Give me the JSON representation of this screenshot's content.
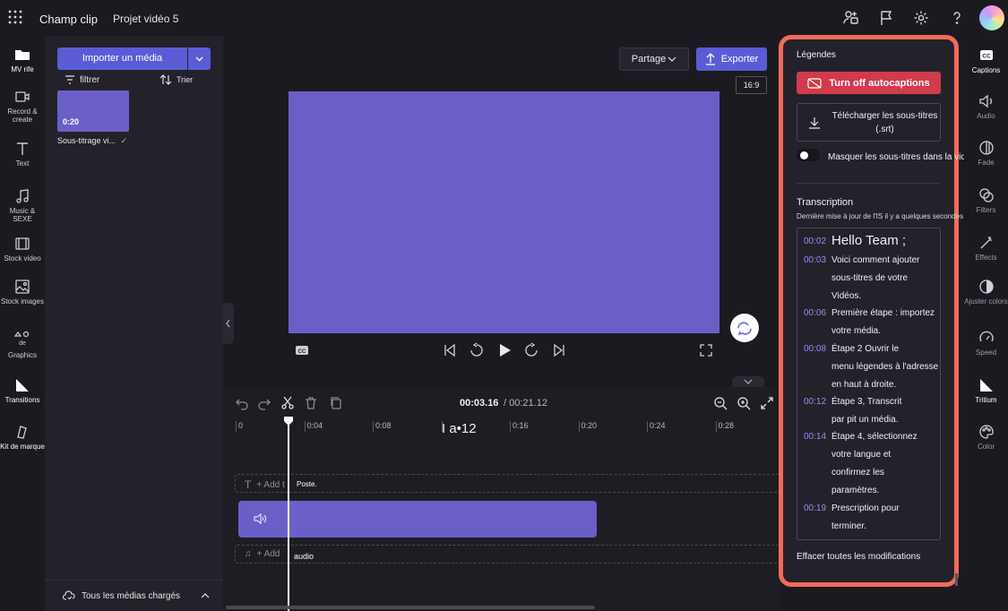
{
  "header": {
    "app_title": "Champ clip",
    "project_name": "Projet vidéo 5"
  },
  "left_rail": {
    "items": [
      {
        "label": "MV rife",
        "icon": "folder-icon"
      },
      {
        "label": "Record & create",
        "icon": "video-camera-icon"
      },
      {
        "label": "Text",
        "icon": "text-icon"
      },
      {
        "label": "Music & SEXE",
        "icon": "music-icon"
      },
      {
        "label": "Stock video",
        "icon": "film-icon"
      },
      {
        "label": "Stock images",
        "icon": "image-icon"
      },
      {
        "label": "Graphics",
        "icon": "shapes-icon"
      },
      {
        "label": "Transitions",
        "icon": "transition-icon"
      },
      {
        "label": "Kit de marque",
        "icon": "brand-kit-icon"
      }
    ],
    "graphics_badge": "de"
  },
  "media_panel": {
    "import_label": "Importer un média",
    "filter_label": "filtrer",
    "sort_label": "Trier",
    "media_item": {
      "duration": "0:20",
      "name": "Sous-titrage vi..."
    },
    "footer_label": "Tous les médias chargés"
  },
  "preview": {
    "share_label": "Partage",
    "export_label": "Exporter",
    "aspect_ratio": "16:9",
    "cc_label": "CC"
  },
  "timeline": {
    "current_time": "00:03.16",
    "total_time": "/ 00:21.12",
    "ticks": [
      "0",
      "0:04",
      "0:08",
      "0:12",
      "0:16",
      "0:20",
      "0:24",
      "0:28"
    ],
    "ruler_overlay": "I a•12",
    "text_track_label": "+ Add t",
    "text_track_overlay": "Poste.",
    "audio_track_label": "+ Add",
    "audio_track_overlay": "audio"
  },
  "captions": {
    "title": "Légendes",
    "turn_off_label": "Turn off autocaptions",
    "download_label": "Télécharger les sous-titres (.srt)",
    "hide_label": "Masquer les sous-titres dans la vidéo",
    "hide_toggle_on": false,
    "transcription_title": "Transcription",
    "last_updated": "Dernière mise à jour de l'IS il y a quelques secondes",
    "entries": [
      {
        "time": "00:02",
        "lines": [
          "Hello Team ;"
        ]
      },
      {
        "time": "00:03",
        "lines": [
          "Voici comment ajouter",
          "sous-titres de votre",
          "Vidéos."
        ]
      },
      {
        "time": "00:06",
        "lines": [
          "Première étape : importez",
          "votre média."
        ]
      },
      {
        "time": "00:08",
        "lines": [
          "Étape 2 Ouvrir le",
          "menu légendes à l'adresse",
          "en haut à droite."
        ]
      },
      {
        "time": "00:12",
        "lines": [
          "Étape 3, Transcrit",
          "par pit un média."
        ]
      },
      {
        "time": "00:14",
        "lines": [
          "Étape 4, sélectionnez",
          "votre langue et",
          "confirmez les",
          "paramètres."
        ]
      },
      {
        "time": "00:19",
        "lines": [
          "Prescription pour",
          "terminer."
        ]
      }
    ],
    "clear_label": "Effacer toutes les modifications"
  },
  "right_rail": {
    "items": [
      {
        "label": "Captions",
        "icon": "captions-icon"
      },
      {
        "label": "Audio",
        "icon": "speaker-icon"
      },
      {
        "label": "Fade",
        "icon": "fade-icon"
      },
      {
        "label": "Filters",
        "icon": "filters-icon"
      },
      {
        "label": "Effects",
        "icon": "magic-wand-icon"
      },
      {
        "label": "Ajuster colors",
        "icon": "adjust-colors-icon"
      },
      {
        "label": "Speed",
        "icon": "speedometer-icon"
      },
      {
        "label": "Tritium",
        "icon": "trim-icon"
      },
      {
        "label": "Color",
        "icon": "palette-icon"
      }
    ]
  },
  "colors": {
    "accent": "#5b5bd6",
    "clip": "#6a5fc7",
    "danger": "#d13b4b",
    "highlight_border": "#f26b5b",
    "timestamp": "#9b8cf0"
  }
}
